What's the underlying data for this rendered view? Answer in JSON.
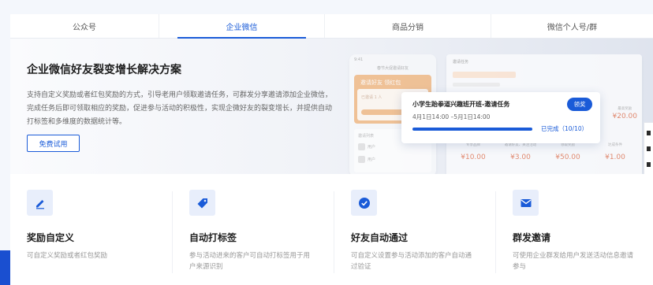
{
  "tabs": [
    {
      "label": "公众号",
      "active": false
    },
    {
      "label": "企业微信",
      "active": true
    },
    {
      "label": "商品分销",
      "active": false
    },
    {
      "label": "微信个人号/群",
      "active": false
    }
  ],
  "hero": {
    "title": "企业微信好友裂变增长解决方案",
    "description": "支持自定义奖励或者红包奖励的方式，引导老用户领取邀请任务，可群发分享邀请添加企业微信，完成任务后即可领取相应的奖励，促进参与活动的积极性，实现企微好友的裂变增长，并提供自动打标签和多维度的数据统计等。",
    "cta_label": "免费试用"
  },
  "illustration": {
    "phone_time": "9:41",
    "phone_title": "春节大促邀请好友",
    "banner_text": "邀请好友  领红包",
    "invite_line": "已邀请 1 人",
    "list_header": "邀请列表",
    "list_row": "用户",
    "panel_header": "邀请任务",
    "task": {
      "title": "小学生跆拳道兴趣班开班-邀请任务",
      "date_range": "4月1日14:00 –5月1日14:00",
      "claim_label": "领奖",
      "progress": 1.0,
      "status": "已完成（10/10）"
    },
    "amounts": [
      {
        "label": "专享品牌",
        "value": "¥10.00"
      },
      {
        "label": "邀请好友、关注活动",
        "value": "¥3.00"
      },
      {
        "label": "领取奖励",
        "value": "¥50.00"
      },
      {
        "label": "达成条件",
        "value": "¥1.00"
      }
    ],
    "side_amount": {
      "label": "最高奖励",
      "value": "¥20.00"
    }
  },
  "features": [
    {
      "icon": "pencil-icon",
      "title": "奖励自定义",
      "desc": "可自定义奖励或者红包奖励"
    },
    {
      "icon": "tag-icon",
      "title": "自动打标签",
      "desc": "参与活动进来的客户可自动打标签用于用户来源识别"
    },
    {
      "icon": "check-circle-icon",
      "title": "好友自动通过",
      "desc": "可自定义设置参与活动添加的客户自动通过验证"
    },
    {
      "icon": "mail-icon",
      "title": "群发邀请",
      "desc": "可使用企业群发给用户发送活动信息邀请参与"
    }
  ],
  "colors": {
    "accent": "#1a5bd8",
    "icon_bg": "#e8eefb",
    "amount": "#e07a5a"
  }
}
